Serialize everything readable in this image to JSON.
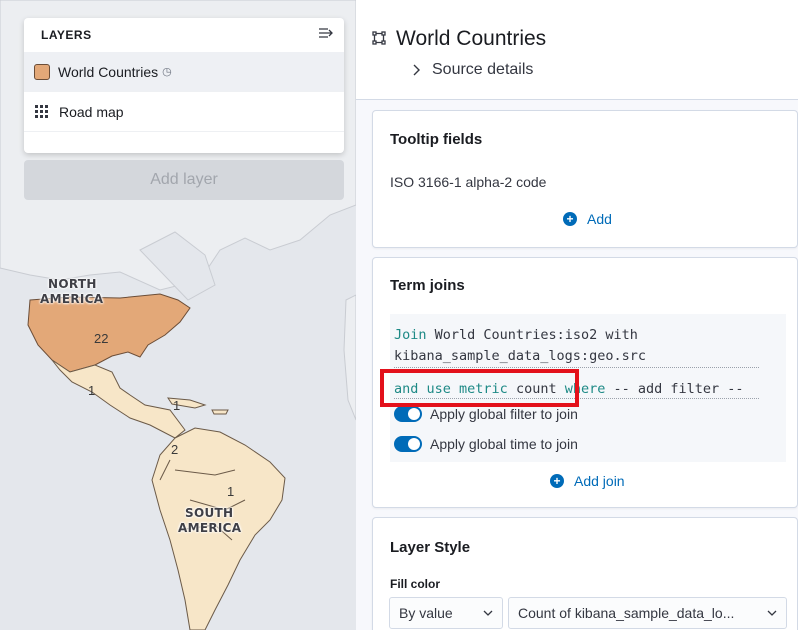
{
  "layers_panel": {
    "title": "LAYERS",
    "items": [
      {
        "label": "World Countries",
        "icon": "swatch-icon",
        "color": "#e3a878",
        "badge_icon": "clock-icon"
      },
      {
        "label": "Road map",
        "icon": "grid-icon"
      }
    ],
    "add_layer_label": "Add layer"
  },
  "map": {
    "labels": {
      "north_america_1": "NORTH",
      "north_america_2": "AMERICA",
      "south_america_1": "SOUTH",
      "south_america_2": "AMERICA"
    },
    "counts": {
      "usa": "22",
      "mexico": "1",
      "caribbean": "1",
      "colombia": "2",
      "brazil": "1"
    },
    "fill_color": "#e3a878",
    "land_color": "#f7e6c8"
  },
  "layer_panel": {
    "title": "World Countries",
    "source_details": "Source details",
    "tooltip": {
      "title": "Tooltip fields",
      "field": "ISO 3166-1 alpha-2 code",
      "add_label": "Add"
    },
    "term_joins": {
      "title": "Term joins",
      "join_kw": "Join",
      "join_left": "World Countries:iso2",
      "with_kw": "with",
      "join_right": "kibana_sample_data_logs:geo.src",
      "metric_prefix": "and use metric",
      "metric_value": "count",
      "where_kw": "where",
      "filter_text": "-- add filter --",
      "toggle_filter": "Apply global filter to join",
      "toggle_time": "Apply global time to join",
      "add_join": "Add join"
    },
    "layer_style": {
      "title": "Layer Style",
      "fill_color_label": "Fill color",
      "fill_type": "By value",
      "fill_field": "Count of kibana_sample_data_lo..."
    }
  },
  "colors": {
    "accent": "#006bb8",
    "highlight": "#e3111b",
    "keyword": "#1e8a86"
  }
}
